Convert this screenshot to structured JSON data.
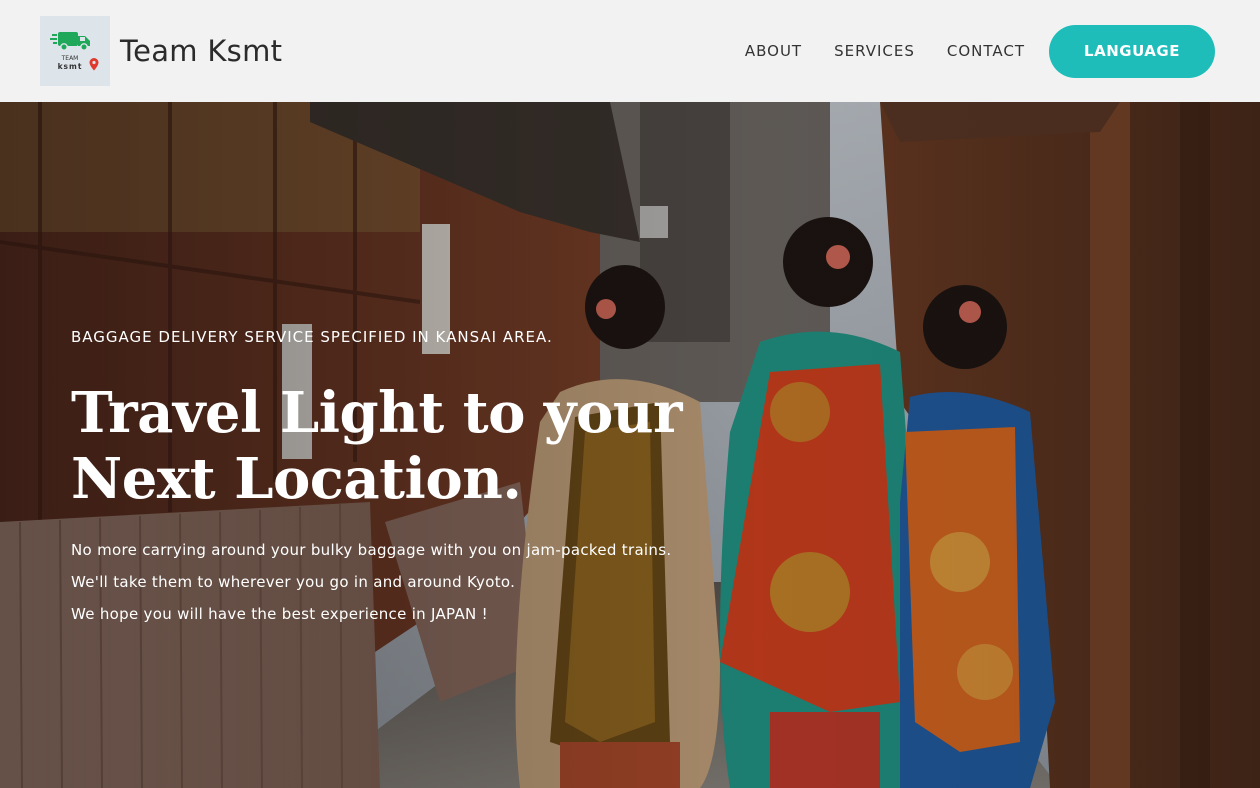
{
  "brand": {
    "logo_text_top": "TEAM",
    "logo_text_bottom": "ksmt",
    "name": "Team Ksmt",
    "colors": {
      "truck": "#1fa85a",
      "pin": "#e03a2f"
    }
  },
  "nav": {
    "items": [
      {
        "label": "ABOUT"
      },
      {
        "label": "SERVICES"
      },
      {
        "label": "CONTACT"
      }
    ],
    "language_button": "LANGUAGE",
    "accent_color": "#1ebdb9"
  },
  "hero": {
    "eyebrow": "BAGGAGE DELIVERY SERVICE SPECIFIED IN KANSAI AREA.",
    "headline_line1": "Travel Light to your",
    "headline_line2": "Next Location.",
    "lines": [
      "No more carrying around your bulky baggage with you on jam-packed trains.",
      "We'll take them to wherever you go in and around Kyoto.",
      "We hope you will have the best experience in JAPAN !"
    ]
  }
}
